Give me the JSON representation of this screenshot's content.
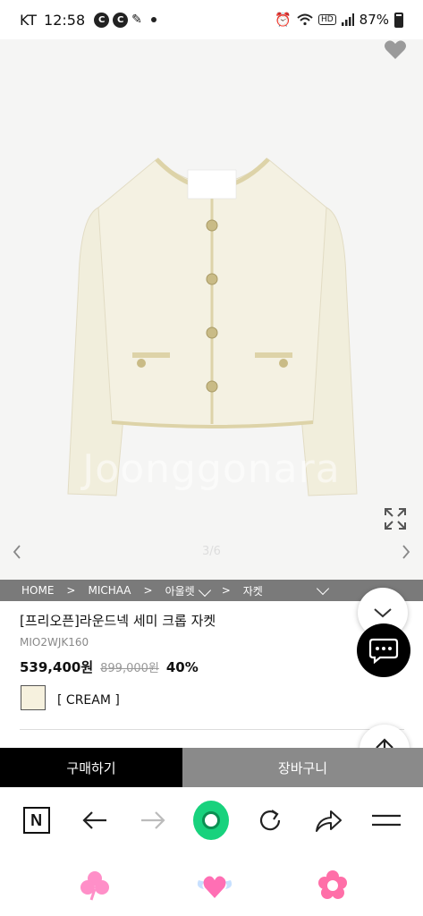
{
  "status_bar": {
    "carrier": "KT",
    "time": "12:58",
    "notif_icons": [
      "C",
      "C"
    ],
    "battery": "87%"
  },
  "gallery": {
    "watermark": "Joonggonara",
    "pager": "3/6"
  },
  "breadcrumb": {
    "home": "HOME",
    "brand": "MICHAA",
    "category": "아울렛",
    "subcategory": "자켓",
    "sep": ">"
  },
  "product": {
    "title": "[프리오픈]라운드넥 세미 크롭 자켓",
    "code": "MIO2WJK160",
    "price": "539,400원",
    "original_price": "899,000원",
    "discount": "40%",
    "color_option": "[ CREAM ]",
    "swatch_color": "#f6f1de"
  },
  "actions": {
    "buy_label": "구매하기",
    "cart_label": "장바구니"
  },
  "nav": {
    "logo_letter": "N"
  },
  "colors": {
    "accent_green": "#18d27d",
    "breadcrumb_bg": "#7a7a7a",
    "cart_bg": "#8a8a8a"
  }
}
